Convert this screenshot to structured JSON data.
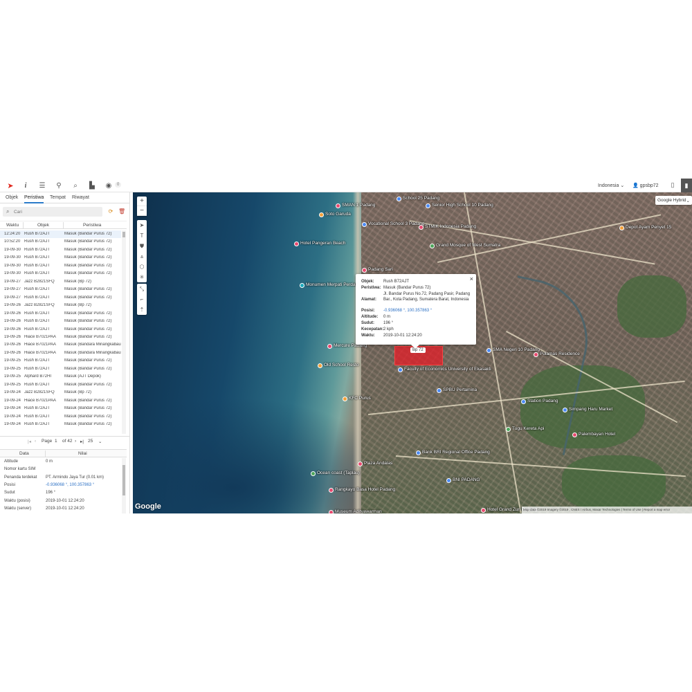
{
  "toolbar": {
    "icons": [
      "logo-icon",
      "info-icon",
      "sliders-icon",
      "map-pin-icon",
      "search-icon",
      "chart-icon",
      "car-icon"
    ],
    "badge": "0",
    "language": "Indonesia",
    "username": "gpsbp72"
  },
  "sidebar": {
    "tabs": [
      "Objek",
      "Peristiwa",
      "Tempat",
      "Riwayat"
    ],
    "active_tab": "Peristiwa",
    "search_placeholder": "Cari",
    "events_headers": [
      "Waktu",
      "Objek",
      "Peristiwa"
    ],
    "events": [
      {
        "time": "12:24:20",
        "object": "Rush B72AJT",
        "event": "Masuk (Bandar Purus 72)"
      },
      {
        "time": "10:52:20",
        "object": "Rush B72AJT",
        "event": "Masuk (Bandar Purus 72)"
      },
      {
        "time": "19-09-30",
        "object": "Rush B72AJT",
        "event": "Masuk (Bandar Purus 72)"
      },
      {
        "time": "19-09-30",
        "object": "Rush B72AJT",
        "event": "Masuk (Bandar Purus 72)"
      },
      {
        "time": "19-09-30",
        "object": "Rush B72AJT",
        "event": "Masuk (Bandar Purus 72)"
      },
      {
        "time": "19-09-30",
        "object": "Rush B72AJT",
        "event": "Masuk (Bandar Purus 72)"
      },
      {
        "time": "19-09-27",
        "object": "Jazz B2821SFQ",
        "event": "Masuk (Bp 72)"
      },
      {
        "time": "19-09-27",
        "object": "Rush B72AJT",
        "event": "Masuk (Bandar Purus 72)"
      },
      {
        "time": "19-09-27",
        "object": "Rush B72AJT",
        "event": "Masuk (Bandar Purus 72)"
      },
      {
        "time": "19-09-26",
        "object": "Jazz B2821SFQ",
        "event": "Masuk (Bp 72)"
      },
      {
        "time": "19-09-26",
        "object": "Rush B72AJT",
        "event": "Masuk (Bandar Purus 72)"
      },
      {
        "time": "19-09-26",
        "object": "Rush B72AJT",
        "event": "Masuk (Bandar Purus 72)"
      },
      {
        "time": "19-09-26",
        "object": "Rush B72AJT",
        "event": "Masuk (Bandar Purus 72)"
      },
      {
        "time": "19-09-26",
        "object": "Hiace B7021PAA",
        "event": "Masuk (Bandar Purus 72)"
      },
      {
        "time": "19-09-26",
        "object": "Hiace B7021PAA",
        "event": "Masuk (Bandara Minangkabau"
      },
      {
        "time": "19-09-26",
        "object": "Hiace B7021PAA",
        "event": "Masuk (Bandara Minangkabau"
      },
      {
        "time": "19-09-25",
        "object": "Rush B72AJT",
        "event": "Masuk (Bandar Purus 72)"
      },
      {
        "time": "19-09-25",
        "object": "Rush B72AJT",
        "event": "Masuk (Bandar Purus 72)"
      },
      {
        "time": "19-09-25",
        "object": "Alphard B72HI",
        "event": "Masuk (AJT Depok)"
      },
      {
        "time": "19-09-25",
        "object": "Rush B72AJT",
        "event": "Masuk (Bandar Purus 72)"
      },
      {
        "time": "19-09-24",
        "object": "Jazz B2821SFQ",
        "event": "Masuk (Bp 72)"
      },
      {
        "time": "19-09-24",
        "object": "Hiace B7021PAA",
        "event": "Masuk (Bandar Purus 72)"
      },
      {
        "time": "19-09-24",
        "object": "Rush B72AJT",
        "event": "Masuk (Bandar Purus 72)"
      },
      {
        "time": "19-09-24",
        "object": "Rush B72AJT",
        "event": "Masuk (Bandar Purus 72)"
      },
      {
        "time": "19-09-24",
        "object": "Rush B72AJT",
        "event": "Masuk (Bandar Purus 72)"
      }
    ],
    "pager": {
      "label": "Page",
      "page": "1",
      "of": "of 42",
      "per_page": "25"
    },
    "details_headers": [
      "Data",
      "Nilai"
    ],
    "details": [
      {
        "key": "Altitude",
        "value": "0 m",
        "link": false
      },
      {
        "key": "Nomor kartu SIM",
        "value": "",
        "link": false
      },
      {
        "key": "Penanda terdekat",
        "value": "PT. Armindo Jaya Tur (0.01 km)",
        "link": false
      },
      {
        "key": "Posisi",
        "value": "-0.936068 °, 100.357863 °",
        "link": true
      },
      {
        "key": "Sudut",
        "value": "196 °",
        "link": false
      },
      {
        "key": "Waktu (posisi)",
        "value": "2019-10-01 12:24:20",
        "link": false
      },
      {
        "key": "Waktu (server)",
        "value": "2019-10-01 12:24:20",
        "link": false
      }
    ]
  },
  "map": {
    "type_label": "Google Hybrid",
    "zoom_in": "+",
    "zoom_out": "−",
    "google_logo": "Google",
    "attribution": "Map data ©2019 Imagery ©2019 , CNES / Airbus, Maxar Technologies | Terms of Use | Report a map error",
    "car_label": "Bp 72",
    "pois": [
      "SMAN 1 Padang",
      "School 25 Padang",
      "Soto Garuda",
      "Senior High School 10 Padang",
      "Vocational School 3 Padang",
      "STMIK Indonesia Padang",
      "Hotel Pangeran Beach",
      "Grand Mosque of West Sumatra",
      "Depot Ayam Penyet 15",
      "Padang Sari",
      "Monumen Merpati Perdamaian",
      "Mercure Padang",
      "Old School Resto",
      "Faculty of Economics University of Ekasakti",
      "SMA Negeri 10 Padang",
      "Polamas Residence",
      "KFC Purus",
      "Station Padang",
      "SPBU Pertamina",
      "Plaza Andalas",
      "Ocean coast (Taplau)",
      "Bank BRI Regional Office Padang",
      "BNI PADANG",
      "Museum Adityawarman",
      "Hotel Grand Zuri Padang",
      "Tugu Kereta Api",
      "Simpang Haru Market",
      "Palembayan Hotel",
      "Rangkayo Basa Hotel Padang"
    ]
  },
  "popup": {
    "rows": [
      {
        "key": "Objek:",
        "value": "Rush B72AJT",
        "link": false
      },
      {
        "key": "Peristiwa:",
        "value": "Masuk (Bandar Purus 72)",
        "link": false
      },
      {
        "key": "Alamat:",
        "value": "Jl. Bandar Purus No.72, Padang Pasir, Padang Bar., Kota Padang, Sumatera Barat, Indonesia",
        "link": false
      },
      {
        "key": "Posisi:",
        "value": "-0.936068 °, 100.357863 °",
        "link": true
      },
      {
        "key": "Altitude:",
        "value": "0 m",
        "link": false
      },
      {
        "key": "Sudut:",
        "value": "196 °",
        "link": false
      },
      {
        "key": "Kecepatan:",
        "value": "2 kph",
        "link": false
      },
      {
        "key": "Waktu:",
        "value": "2019-10-01 12:24:20",
        "link": false
      }
    ]
  }
}
